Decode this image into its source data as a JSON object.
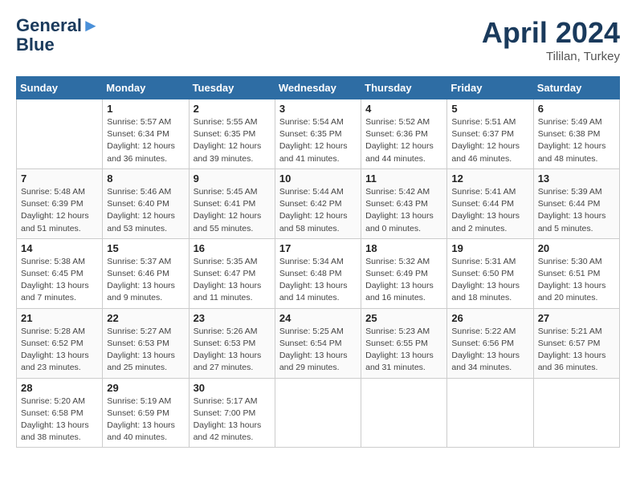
{
  "header": {
    "logo_line1": "General",
    "logo_line2": "Blue",
    "month": "April 2024",
    "location": "Tililan, Turkey"
  },
  "weekdays": [
    "Sunday",
    "Monday",
    "Tuesday",
    "Wednesday",
    "Thursday",
    "Friday",
    "Saturday"
  ],
  "weeks": [
    [
      {
        "num": "",
        "info": ""
      },
      {
        "num": "1",
        "info": "Sunrise: 5:57 AM\nSunset: 6:34 PM\nDaylight: 12 hours\nand 36 minutes."
      },
      {
        "num": "2",
        "info": "Sunrise: 5:55 AM\nSunset: 6:35 PM\nDaylight: 12 hours\nand 39 minutes."
      },
      {
        "num": "3",
        "info": "Sunrise: 5:54 AM\nSunset: 6:35 PM\nDaylight: 12 hours\nand 41 minutes."
      },
      {
        "num": "4",
        "info": "Sunrise: 5:52 AM\nSunset: 6:36 PM\nDaylight: 12 hours\nand 44 minutes."
      },
      {
        "num": "5",
        "info": "Sunrise: 5:51 AM\nSunset: 6:37 PM\nDaylight: 12 hours\nand 46 minutes."
      },
      {
        "num": "6",
        "info": "Sunrise: 5:49 AM\nSunset: 6:38 PM\nDaylight: 12 hours\nand 48 minutes."
      }
    ],
    [
      {
        "num": "7",
        "info": "Sunrise: 5:48 AM\nSunset: 6:39 PM\nDaylight: 12 hours\nand 51 minutes."
      },
      {
        "num": "8",
        "info": "Sunrise: 5:46 AM\nSunset: 6:40 PM\nDaylight: 12 hours\nand 53 minutes."
      },
      {
        "num": "9",
        "info": "Sunrise: 5:45 AM\nSunset: 6:41 PM\nDaylight: 12 hours\nand 55 minutes."
      },
      {
        "num": "10",
        "info": "Sunrise: 5:44 AM\nSunset: 6:42 PM\nDaylight: 12 hours\nand 58 minutes."
      },
      {
        "num": "11",
        "info": "Sunrise: 5:42 AM\nSunset: 6:43 PM\nDaylight: 13 hours\nand 0 minutes."
      },
      {
        "num": "12",
        "info": "Sunrise: 5:41 AM\nSunset: 6:44 PM\nDaylight: 13 hours\nand 2 minutes."
      },
      {
        "num": "13",
        "info": "Sunrise: 5:39 AM\nSunset: 6:44 PM\nDaylight: 13 hours\nand 5 minutes."
      }
    ],
    [
      {
        "num": "14",
        "info": "Sunrise: 5:38 AM\nSunset: 6:45 PM\nDaylight: 13 hours\nand 7 minutes."
      },
      {
        "num": "15",
        "info": "Sunrise: 5:37 AM\nSunset: 6:46 PM\nDaylight: 13 hours\nand 9 minutes."
      },
      {
        "num": "16",
        "info": "Sunrise: 5:35 AM\nSunset: 6:47 PM\nDaylight: 13 hours\nand 11 minutes."
      },
      {
        "num": "17",
        "info": "Sunrise: 5:34 AM\nSunset: 6:48 PM\nDaylight: 13 hours\nand 14 minutes."
      },
      {
        "num": "18",
        "info": "Sunrise: 5:32 AM\nSunset: 6:49 PM\nDaylight: 13 hours\nand 16 minutes."
      },
      {
        "num": "19",
        "info": "Sunrise: 5:31 AM\nSunset: 6:50 PM\nDaylight: 13 hours\nand 18 minutes."
      },
      {
        "num": "20",
        "info": "Sunrise: 5:30 AM\nSunset: 6:51 PM\nDaylight: 13 hours\nand 20 minutes."
      }
    ],
    [
      {
        "num": "21",
        "info": "Sunrise: 5:28 AM\nSunset: 6:52 PM\nDaylight: 13 hours\nand 23 minutes."
      },
      {
        "num": "22",
        "info": "Sunrise: 5:27 AM\nSunset: 6:53 PM\nDaylight: 13 hours\nand 25 minutes."
      },
      {
        "num": "23",
        "info": "Sunrise: 5:26 AM\nSunset: 6:53 PM\nDaylight: 13 hours\nand 27 minutes."
      },
      {
        "num": "24",
        "info": "Sunrise: 5:25 AM\nSunset: 6:54 PM\nDaylight: 13 hours\nand 29 minutes."
      },
      {
        "num": "25",
        "info": "Sunrise: 5:23 AM\nSunset: 6:55 PM\nDaylight: 13 hours\nand 31 minutes."
      },
      {
        "num": "26",
        "info": "Sunrise: 5:22 AM\nSunset: 6:56 PM\nDaylight: 13 hours\nand 34 minutes."
      },
      {
        "num": "27",
        "info": "Sunrise: 5:21 AM\nSunset: 6:57 PM\nDaylight: 13 hours\nand 36 minutes."
      }
    ],
    [
      {
        "num": "28",
        "info": "Sunrise: 5:20 AM\nSunset: 6:58 PM\nDaylight: 13 hours\nand 38 minutes."
      },
      {
        "num": "29",
        "info": "Sunrise: 5:19 AM\nSunset: 6:59 PM\nDaylight: 13 hours\nand 40 minutes."
      },
      {
        "num": "30",
        "info": "Sunrise: 5:17 AM\nSunset: 7:00 PM\nDaylight: 13 hours\nand 42 minutes."
      },
      {
        "num": "",
        "info": ""
      },
      {
        "num": "",
        "info": ""
      },
      {
        "num": "",
        "info": ""
      },
      {
        "num": "",
        "info": ""
      }
    ]
  ]
}
